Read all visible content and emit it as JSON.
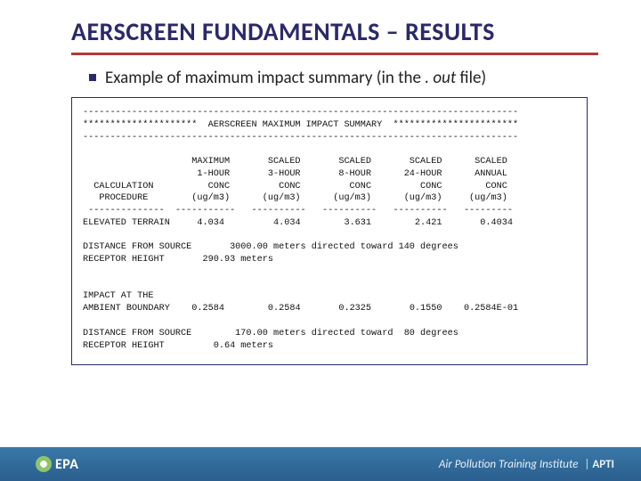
{
  "title": "AERSCREEN FUNDAMENTALS – RESULTS",
  "subtitle_prefix": "Example of maximum impact summary (in the ",
  "subtitle_em": ". out",
  "subtitle_suffix": " file)",
  "out": {
    "hr1": "--------------------------------------------------------------------------------",
    "banner": "*********************  AERSCREEN MAXIMUM IMPACT SUMMARY  ***********************",
    "hr2": "--------------------------------------------------------------------------------",
    "header_line1": "                    MAXIMUM       SCALED       SCALED       SCALED      SCALED",
    "header_line2": "                     1-HOUR       3-HOUR       8-HOUR      24-HOUR      ANNUAL",
    "header_line3": "  CALCULATION          CONC         CONC         CONC         CONC        CONC",
    "header_line4": "   PROCEDURE        (ug/m3)      (ug/m3)      (ug/m3)      (ug/m3)     (ug/m3)",
    "header_rule": " --------------  -----------   ----------   ----------   ----------   ---------",
    "row1_label": "ELEVATED TERRAIN",
    "row1_values": "     4.034         4.034        3.631        2.421       0.4034",
    "dist1": "DISTANCE FROM SOURCE       3000.00 meters directed toward 140 degrees",
    "recpt1": "RECEPTOR HEIGHT       290.93 meters",
    "row2_label1": "IMPACT AT THE",
    "row2_label2": "AMBIENT BOUNDARY",
    "row2_values": "    0.2584        0.2584       0.2325       0.1550    0.2584E-01",
    "dist2": "DISTANCE FROM SOURCE        170.00 meters directed toward  80 degrees",
    "recpt2": "RECEPTOR HEIGHT         0.64 meters"
  },
  "footer": {
    "epa": "EPA",
    "apti_full": "Air Pollution Training Institute",
    "bar": "|",
    "apti_short": "APTI"
  },
  "chart_data": {
    "type": "table",
    "title": "AERSCREEN MAXIMUM IMPACT SUMMARY",
    "columns": [
      "CALCULATION PROCEDURE",
      "MAXIMUM 1-HOUR CONC (ug/m3)",
      "SCALED 3-HOUR CONC (ug/m3)",
      "SCALED 8-HOUR CONC (ug/m3)",
      "SCALED 24-HOUR CONC (ug/m3)",
      "SCALED ANNUAL CONC (ug/m3)"
    ],
    "rows": [
      {
        "procedure": "ELEVATED TERRAIN",
        "values": [
          4.034,
          4.034,
          3.631,
          2.421,
          0.4034
        ],
        "distance_m": 3000.0,
        "direction_deg": 140,
        "receptor_height_m": 290.93
      },
      {
        "procedure": "IMPACT AT THE AMBIENT BOUNDARY",
        "values": [
          0.2584,
          0.2584,
          0.2325,
          0.155,
          0.02584
        ],
        "distance_m": 170.0,
        "direction_deg": 80,
        "receptor_height_m": 0.64
      }
    ]
  }
}
